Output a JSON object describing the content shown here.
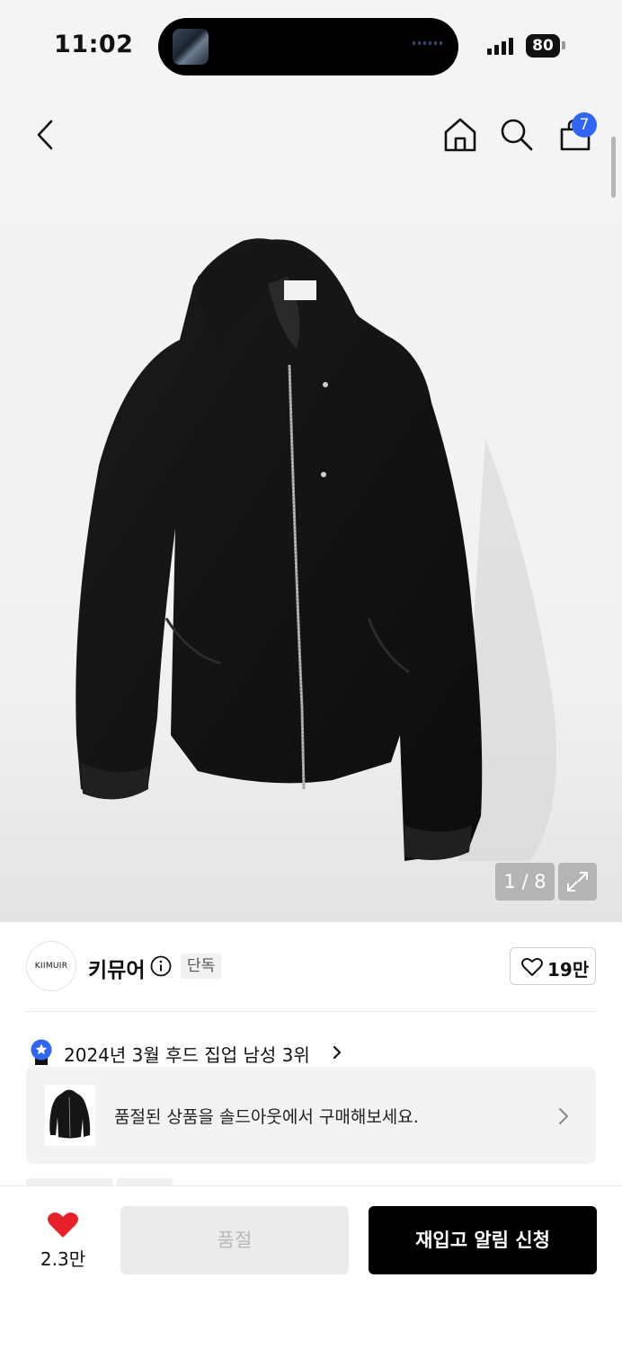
{
  "status_bar": {
    "time": "11:02",
    "battery": "80"
  },
  "header": {
    "cart_count": "7"
  },
  "gallery": {
    "counter": "1 / 8",
    "current_image": 1,
    "total_images": 8
  },
  "brand": {
    "logo_text": "KIIMUIR",
    "name": "키뮤어",
    "badge": "단독",
    "like_count": "19만"
  },
  "ranking": {
    "text": "2024년 3월 후드 집업 남성 3위"
  },
  "soldout_banner": {
    "text": "품절된 상품을 솔드아웃에서 구매해보세요."
  },
  "bottom_bar": {
    "wish_count": "2.3만",
    "soldout_label": "품절",
    "restock_label": "재입고 알림 신청"
  },
  "colors": {
    "accent_blue": "#2f66f5",
    "heart_red": "#e8202a",
    "primary_black": "#000000"
  }
}
